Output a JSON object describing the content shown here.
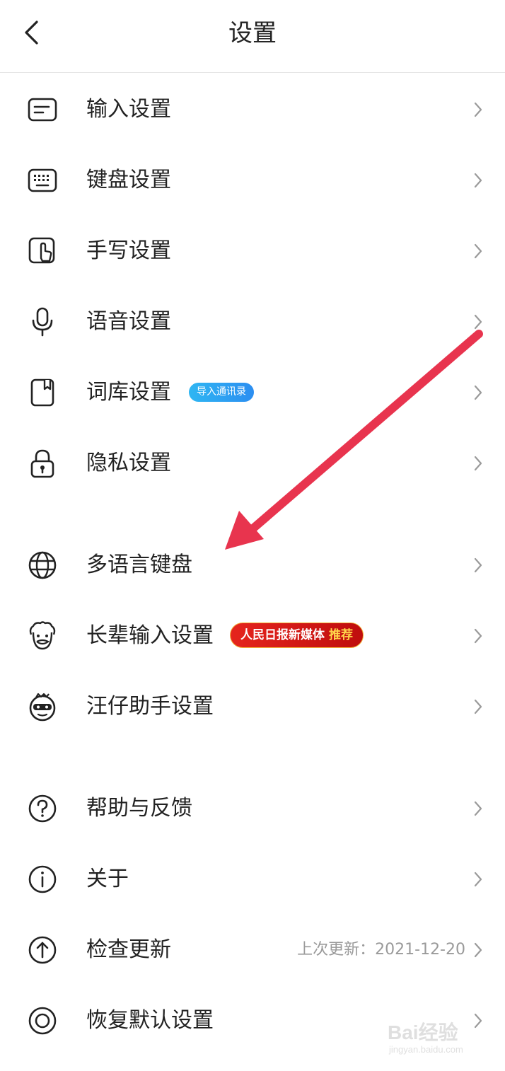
{
  "header": {
    "title": "设置",
    "back_icon": "chevron-left-icon"
  },
  "groups": [
    {
      "items": [
        {
          "label": "输入设置",
          "icon": "input-box-icon"
        },
        {
          "label": "键盘设置",
          "icon": "keyboard-icon"
        },
        {
          "label": "手写设置",
          "icon": "handwriting-icon"
        },
        {
          "label": "语音设置",
          "icon": "microphone-icon"
        },
        {
          "label": "词库设置",
          "icon": "dictionary-book-icon",
          "badge": "导入通讯录"
        },
        {
          "label": "隐私设置",
          "icon": "lock-icon"
        }
      ]
    },
    {
      "items": [
        {
          "label": "多语言键盘",
          "icon": "globe-icon"
        },
        {
          "label": "长辈输入设置",
          "icon": "elder-face-icon",
          "badge": "人民日报新媒体",
          "badge_highlight": "推荐"
        },
        {
          "label": "汪仔助手设置",
          "icon": "assistant-face-icon"
        }
      ]
    },
    {
      "items": [
        {
          "label": "帮助与反馈",
          "icon": "question-circle-icon"
        },
        {
          "label": "关于",
          "icon": "info-circle-icon"
        },
        {
          "label": "检查更新",
          "icon": "upload-arrow-circle-icon",
          "secondary": "上次更新：2021-12-20"
        },
        {
          "label": "恢复默认设置",
          "icon": "reset-ring-icon"
        }
      ]
    }
  ],
  "watermark": {
    "text": "Bai经验",
    "url": "jingyan.baidu.com"
  },
  "colors": {
    "arrow": "#e8344e",
    "badge_blue": "#2c9cf2",
    "badge_red": "#d81b16",
    "text": "#222222",
    "secondary_text": "#9a9a9a"
  }
}
